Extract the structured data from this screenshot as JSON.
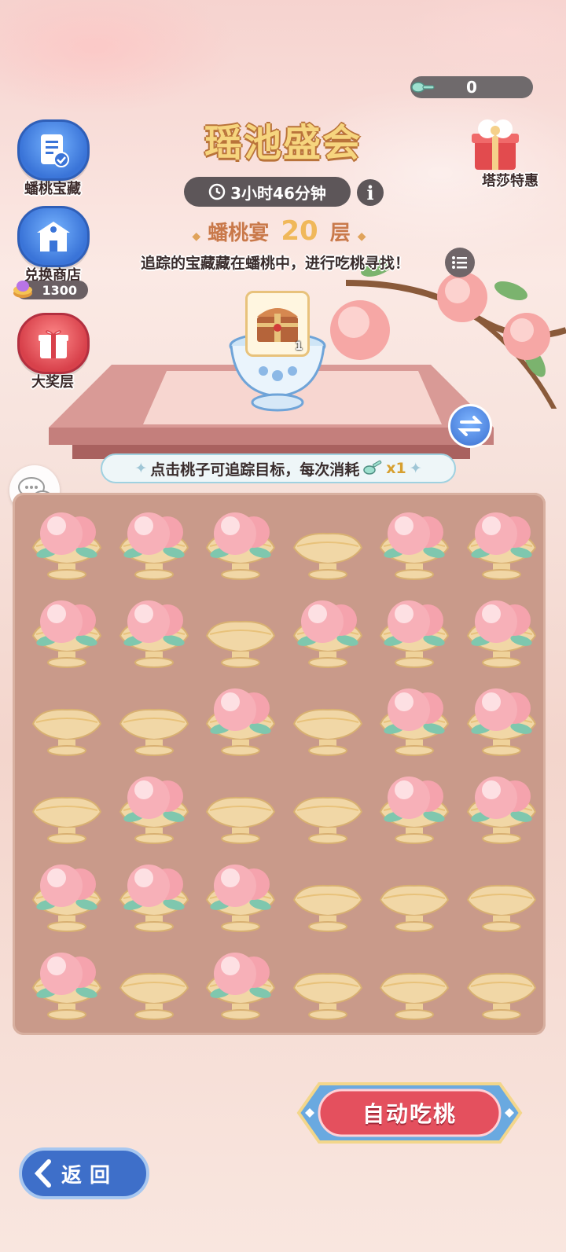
{
  "header": {
    "spoon_count": "0",
    "title": "瑶池盛会",
    "timer": "3小时46分钟",
    "info_label": "i",
    "floor_prefix": "蟠桃宴",
    "floor_number": "20",
    "floor_suffix": "层",
    "hint": "追踪的宝藏藏在蟠桃中，进行吃桃寻找！"
  },
  "side_menu": {
    "treasure_label": "蟠桃宝藏",
    "shop_label": "兑换商店",
    "coins": "1300",
    "grand_prize_label": "大奖层"
  },
  "gift_label": "塔莎特惠",
  "reward": {
    "count": "1"
  },
  "tip": {
    "text": "点击桃子可追踪目标，每次消耗",
    "cost": "x1"
  },
  "board": {
    "rows": [
      [
        1,
        1,
        1,
        0,
        1,
        1
      ],
      [
        1,
        1,
        0,
        1,
        1,
        1
      ],
      [
        0,
        0,
        1,
        0,
        1,
        1
      ],
      [
        0,
        1,
        0,
        0,
        1,
        1
      ],
      [
        1,
        1,
        1,
        0,
        0,
        0
      ],
      [
        1,
        0,
        1,
        0,
        0,
        0
      ]
    ],
    "legend": {
      "1": "peach-in-bowl",
      "0": "empty-bowl"
    }
  },
  "buttons": {
    "auto_eat": "自动吃桃",
    "back": "返回"
  },
  "colors": {
    "title": "#f6d57e",
    "board": "#c99a8a",
    "accent_red": "#e4505e",
    "accent_blue": "#3a74d8"
  }
}
